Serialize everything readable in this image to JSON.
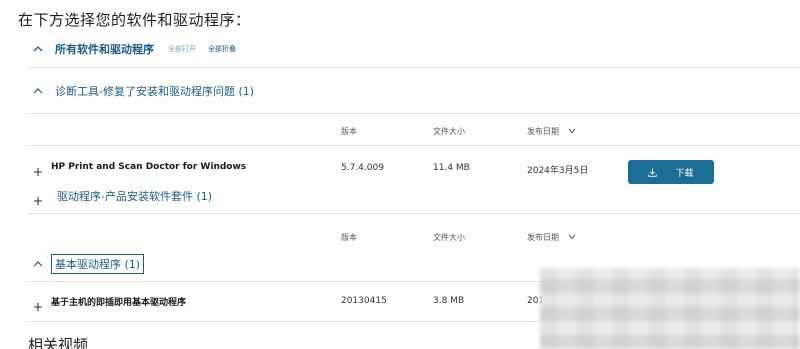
{
  "page": {
    "title": "在下方选择您的软件和驱动程序：",
    "footer_title": "相关视频"
  },
  "all_section": {
    "title": "所有软件和驱动程序",
    "expand_all": "全部打开",
    "collapse_all": "全部折叠"
  },
  "sections": [
    {
      "title": "诊断工具-修复了安装和驱动程序问题 (1)",
      "columns": {
        "version": "版本",
        "size": "文件大小",
        "date": "发布日期"
      },
      "items": [
        {
          "name": "HP Print and Scan Doctor for Windows",
          "version": "5.7.4.009",
          "size": "11.4 MB",
          "date": "2024年3月5日",
          "download_label": "下载"
        }
      ]
    },
    {
      "title": "驱动程序-产品安装软件套件 (1)",
      "columns": {
        "version": "版本",
        "size": "文件大小",
        "date": "发布日期"
      }
    },
    {
      "title": "基本驱动程序 (1)",
      "items": [
        {
          "name": "基于主机的即插即用基本驱动程序",
          "version": "20130415",
          "size": "3.8 MB",
          "date_partial": "201"
        }
      ]
    }
  ],
  "colors": {
    "accent": "#1b5e86",
    "button": "#1c6d96"
  },
  "icons": {
    "collapse": "chevron-up-icon",
    "expand": "plus-icon",
    "sort": "chevron-down-icon",
    "download": "download-icon"
  }
}
